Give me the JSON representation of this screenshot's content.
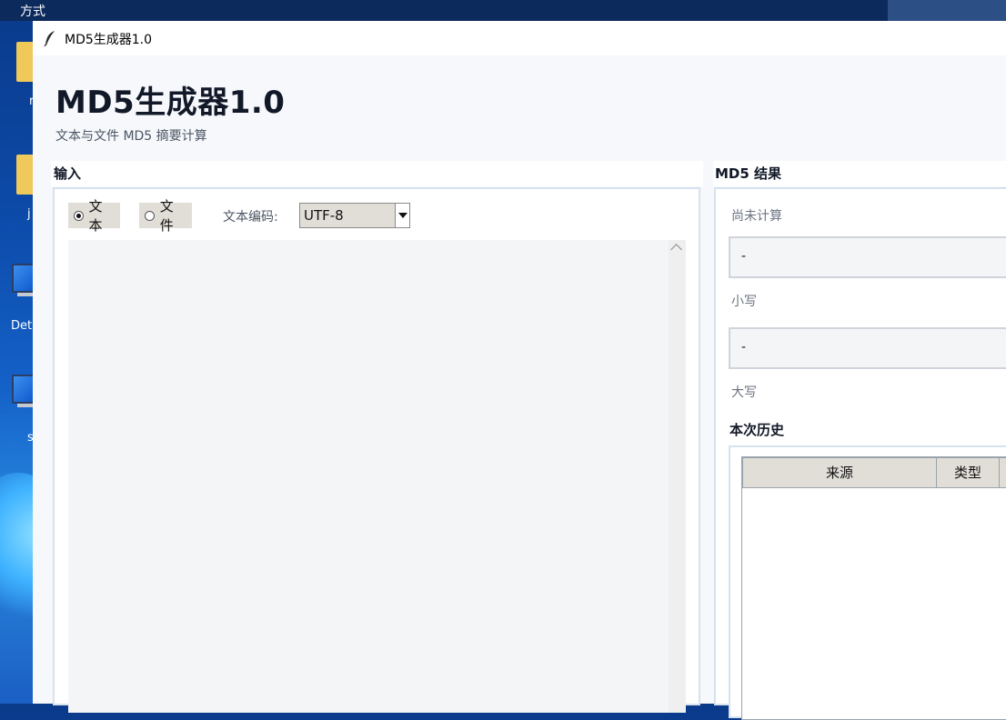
{
  "desktop": {
    "taskbar_label": "方式",
    "icon_labels": [
      "r",
      "j",
      "Det",
      "s"
    ]
  },
  "window": {
    "title": "MD5生成器1.0"
  },
  "app": {
    "title": "MD5生成器1.0",
    "subtitle": "文本与文件 MD5 摘要计算"
  },
  "input": {
    "section_title": "输入",
    "mode_text": "文本",
    "mode_file": "文件",
    "selected_mode": "text",
    "encoding_label": "文本编码:",
    "encoding_value": "UTF-8",
    "text_value": ""
  },
  "result": {
    "section_title": "MD5 结果",
    "status": "尚未计算",
    "lower_value": "-",
    "lower_label": "小写",
    "upper_value": "-",
    "upper_label": "大写"
  },
  "history": {
    "title": "本次历史",
    "columns": [
      "来源",
      "类型"
    ]
  }
}
